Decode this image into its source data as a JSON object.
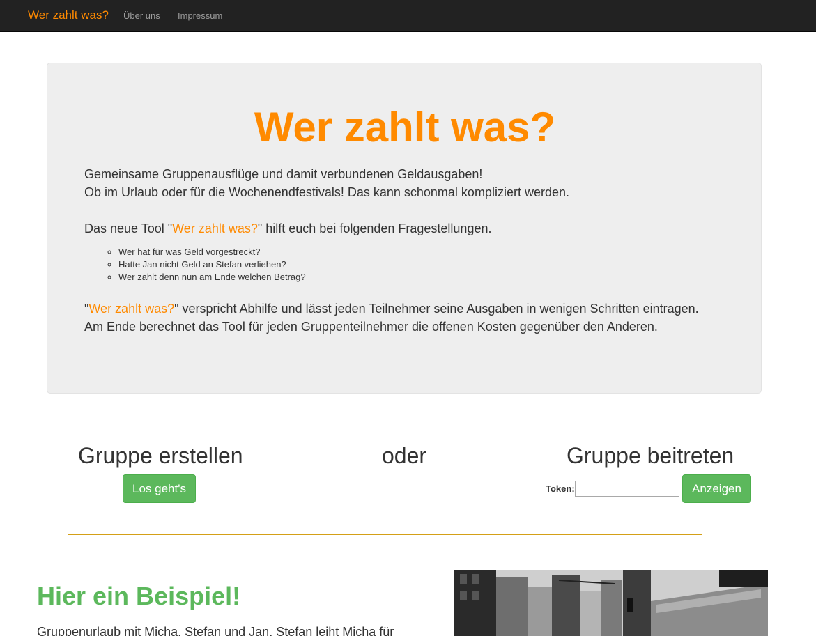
{
  "navbar": {
    "brand": "Wer zahlt was?",
    "links": [
      "Über uns",
      "Impressum"
    ]
  },
  "hero": {
    "title": "Wer zahlt was?",
    "intro_line1": "Gemeinsame Gruppenausflüge und damit verbundenen Geldausgaben!",
    "intro_line2": "Ob im Urlaub oder für die Wochenendfestivals! Das kann schonmal kompliziert werden.",
    "tool_prefix": "Das neue Tool \"",
    "tool_name": "Wer zahlt was?",
    "tool_suffix": "\" hilft euch bei folgenden Fragestellungen.",
    "questions": [
      "Wer hat für was Geld vorgestreckt?",
      "Hatte Jan nicht Geld an Stefan verliehen?",
      "Wer zahlt denn nun am Ende welchen Betrag?"
    ],
    "promise_prefix": "\"",
    "promise_name": "Wer zahlt was?",
    "promise_suffix": "\" verspricht Abhilfe und lässt jeden Teilnehmer seine Ausgaben in wenigen Schritten eintragen.",
    "closing": "Am Ende berechnet das Tool für jeden Gruppenteilnehmer die offenen Kosten gegenüber den Anderen."
  },
  "actions": {
    "create_heading": "Gruppe erstellen",
    "or_text": "oder",
    "join_heading": "Gruppe beitreten",
    "go_button": "Los geht's",
    "token_label": "Token:",
    "token_value": "",
    "show_button": "Anzeigen"
  },
  "example": {
    "title": "Hier ein Beispiel!",
    "text": "Gruppenurlaub mit Micha, Stefan und Jan. Stefan leiht Micha für"
  },
  "colors": {
    "brand_orange": "#ff8a00",
    "success_green": "#5cb85c",
    "navbar_bg": "#222222",
    "jumbotron_bg": "#eeeeee",
    "divider": "#d4a017"
  }
}
